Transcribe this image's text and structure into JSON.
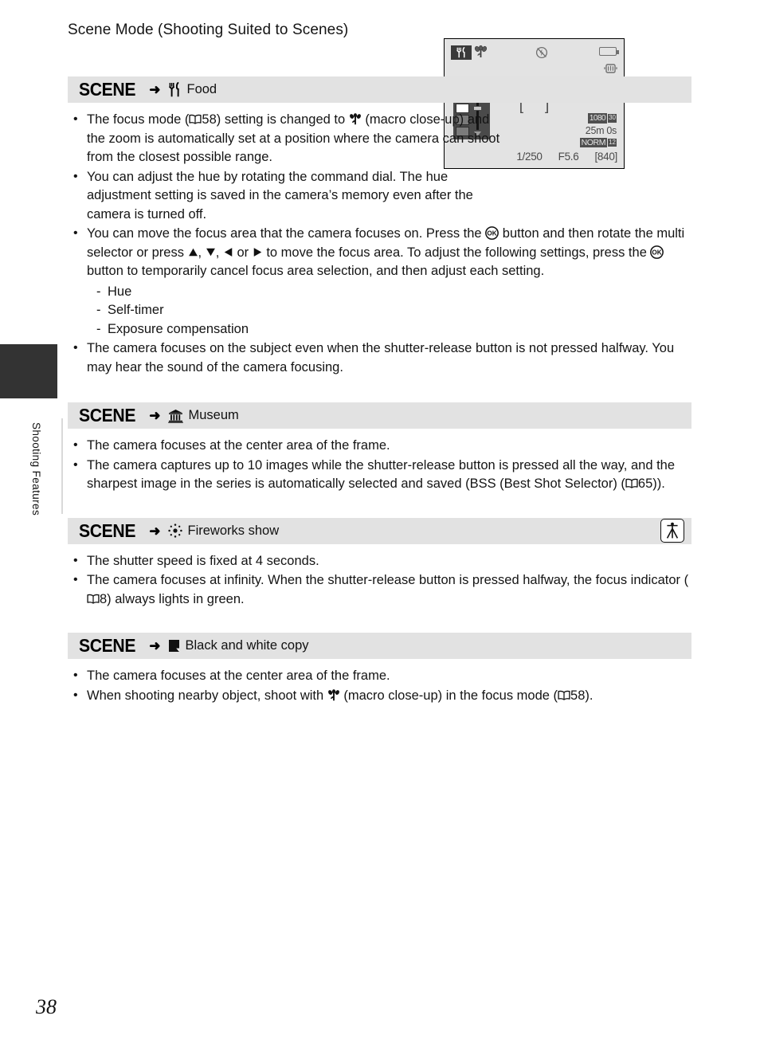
{
  "page": {
    "title": "Scene Mode (Shooting Suited to Scenes)",
    "number": "38",
    "side_tab_label": "Shooting Features"
  },
  "scene_word": "SCENE",
  "arrow": "➜",
  "sections": [
    {
      "id": "food",
      "icon": "fork-knife-icon",
      "title": "Food",
      "has_tripod_badge": false,
      "bullets": [
        {
          "parts": [
            {
              "t": "text",
              "v": "The focus mode ("
            },
            {
              "t": "icon",
              "v": "book-icon"
            },
            {
              "t": "text",
              "v": "58) setting is changed to "
            },
            {
              "t": "icon",
              "v": "macro-flower-icon"
            },
            {
              "t": "text",
              "v": " (macro close-up) and the zoom is automatically set at a position where the camera can shoot from the closest possible range."
            }
          ]
        },
        {
          "parts": [
            {
              "t": "text",
              "v": "You can adjust the hue by rotating the command dial. The hue adjustment setting is saved in the camera’s memory even after the camera is turned off."
            }
          ]
        },
        {
          "parts": [
            {
              "t": "text",
              "v": "You can move the focus area that the camera focuses on. Press the "
            },
            {
              "t": "icon",
              "v": "ok-button-icon"
            },
            {
              "t": "text",
              "v": " button and then rotate the multi selector or press "
            },
            {
              "t": "icon",
              "v": "triangle-up-icon"
            },
            {
              "t": "text",
              "v": ", "
            },
            {
              "t": "icon",
              "v": "triangle-down-icon"
            },
            {
              "t": "text",
              "v": ", "
            },
            {
              "t": "icon",
              "v": "triangle-left-icon"
            },
            {
              "t": "text",
              "v": " or "
            },
            {
              "t": "icon",
              "v": "triangle-right-icon"
            },
            {
              "t": "text",
              "v": " to move the focus area. To adjust the following settings, press the "
            },
            {
              "t": "icon",
              "v": "ok-button-icon"
            },
            {
              "t": "text",
              "v": " button to temporarily cancel focus area selection, and then adjust each setting."
            }
          ],
          "sub": [
            "Hue",
            "Self-timer",
            "Exposure compensation"
          ]
        },
        {
          "parts": [
            {
              "t": "text",
              "v": "The camera focuses on the subject even when the shutter-release button is not pressed halfway. You may hear the sound of the camera focusing."
            }
          ]
        }
      ]
    },
    {
      "id": "museum",
      "icon": "museum-building-icon",
      "title": "Museum",
      "has_tripod_badge": false,
      "bullets": [
        {
          "parts": [
            {
              "t": "text",
              "v": "The camera focuses at the center area of the frame."
            }
          ]
        },
        {
          "parts": [
            {
              "t": "text",
              "v": "The camera captures up to 10 images while the shutter-release button is pressed all the way, and the sharpest image in the series is automatically selected and saved (BSS (Best Shot Selector) ("
            },
            {
              "t": "icon",
              "v": "book-icon"
            },
            {
              "t": "text",
              "v": "65))."
            }
          ]
        }
      ]
    },
    {
      "id": "fireworks",
      "icon": "fireworks-burst-icon",
      "title": "Fireworks show",
      "has_tripod_badge": true,
      "badge_icon": "tripod-icon",
      "bullets": [
        {
          "parts": [
            {
              "t": "text",
              "v": "The shutter speed is fixed at 4 seconds."
            }
          ]
        },
        {
          "parts": [
            {
              "t": "text",
              "v": "The camera focuses at infinity. When the shutter-release button is pressed halfway, the focus indicator ("
            },
            {
              "t": "icon",
              "v": "book-icon"
            },
            {
              "t": "text",
              "v": "8) always lights in green."
            }
          ]
        }
      ]
    },
    {
      "id": "bw-copy",
      "icon": "black-white-copy-icon",
      "title": "Black and white copy",
      "has_tripod_badge": false,
      "bullets": [
        {
          "parts": [
            {
              "t": "text",
              "v": "The camera focuses at the center area of the frame."
            }
          ]
        },
        {
          "parts": [
            {
              "t": "text",
              "v": "When shooting nearby object, shoot with "
            },
            {
              "t": "icon",
              "v": "macro-flower-icon"
            },
            {
              "t": "text",
              "v": " (macro close-up) in the focus mode ("
            },
            {
              "t": "icon",
              "v": "book-icon"
            },
            {
              "t": "text",
              "v": "58)."
            }
          ]
        }
      ]
    }
  ],
  "lcd": {
    "mode_icon": "fork-knife-icon",
    "macro_icon": "macro-flower-icon",
    "flash_icon": "flash-off-icon",
    "battery_icon": "battery-icon",
    "vr_icon": "vibration-reduction-icon",
    "hue_slider": {
      "swatch_count": 5,
      "selected_index": 2
    },
    "focus_bracket_left": "[",
    "focus_bracket_right": "]",
    "movie_size": "1080",
    "movie_fps": "30",
    "movie_time": "25m 0s",
    "image_quality": "NORM",
    "image_size": "12",
    "shutter_speed": "1/250",
    "aperture": "F5.6",
    "shots_remaining": "840"
  }
}
